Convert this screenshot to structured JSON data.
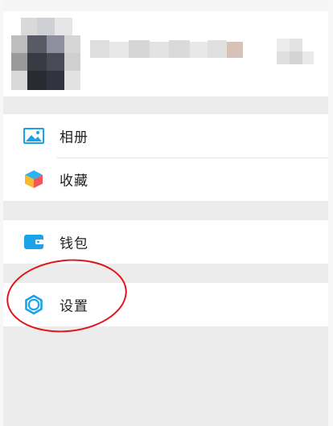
{
  "profile": {
    "avatar": "avatar",
    "name": "",
    "subtitle": ""
  },
  "menu": {
    "album": {
      "label": "相册",
      "icon": "photo-album-icon"
    },
    "favorites": {
      "label": "收藏",
      "icon": "cube-favorites-icon"
    },
    "wallet": {
      "label": "钱包",
      "icon": "wallet-icon"
    },
    "settings": {
      "label": "设置",
      "icon": "gear-icon"
    }
  },
  "colors": {
    "accent": "#1aa3e8",
    "annotation": "#e0141a",
    "background": "#ececec"
  }
}
